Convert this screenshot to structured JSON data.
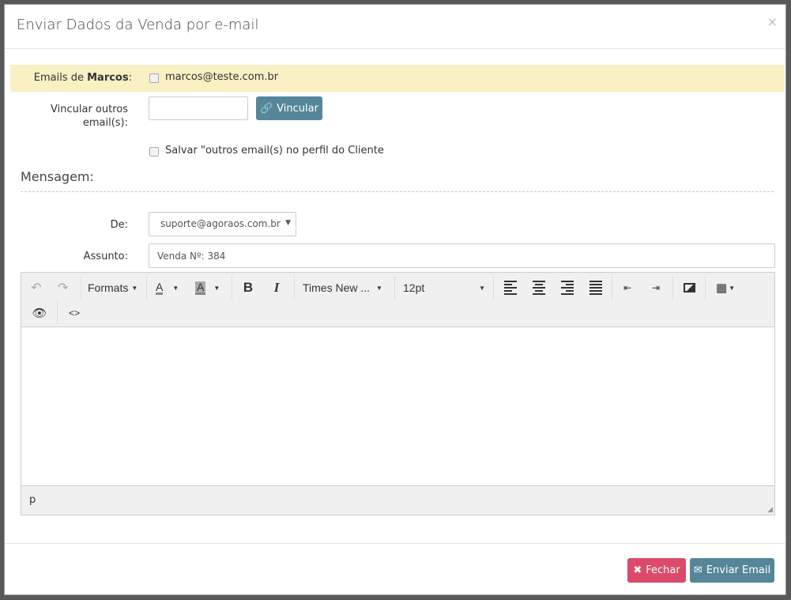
{
  "modal": {
    "title": "Enviar Dados da Venda por e-mail",
    "close": "×"
  },
  "emails": {
    "label_prefix": "Emails de ",
    "client_name": "Marcos",
    "label_suffix": ":",
    "address": "marcos@teste.com.br",
    "checked": false
  },
  "link": {
    "label": "Vincular outros email(s):",
    "value": "",
    "button": "Vincular"
  },
  "save": {
    "label": "Salvar \"outros email(s) no perfil do Cliente",
    "checked": false
  },
  "message": {
    "section_title": "Mensagem:",
    "from_label": "De:",
    "from_value": "suporte@agoraos.com.br",
    "subject_label": "Assunto:",
    "subject_value": "Venda Nº: 384"
  },
  "editor": {
    "formats": "Formats",
    "font": "Times New ...",
    "size": "12pt",
    "status_path": "p",
    "text_color_glyph": "A",
    "bg_color_glyph": "A",
    "bold": "B",
    "italic": "I",
    "code": "<>"
  },
  "footer": {
    "close": "Fechar",
    "send": "Enviar Email"
  },
  "colors": {
    "primary": "#558799",
    "danger": "#dc4a6a",
    "highlight": "#f9f0c3"
  }
}
